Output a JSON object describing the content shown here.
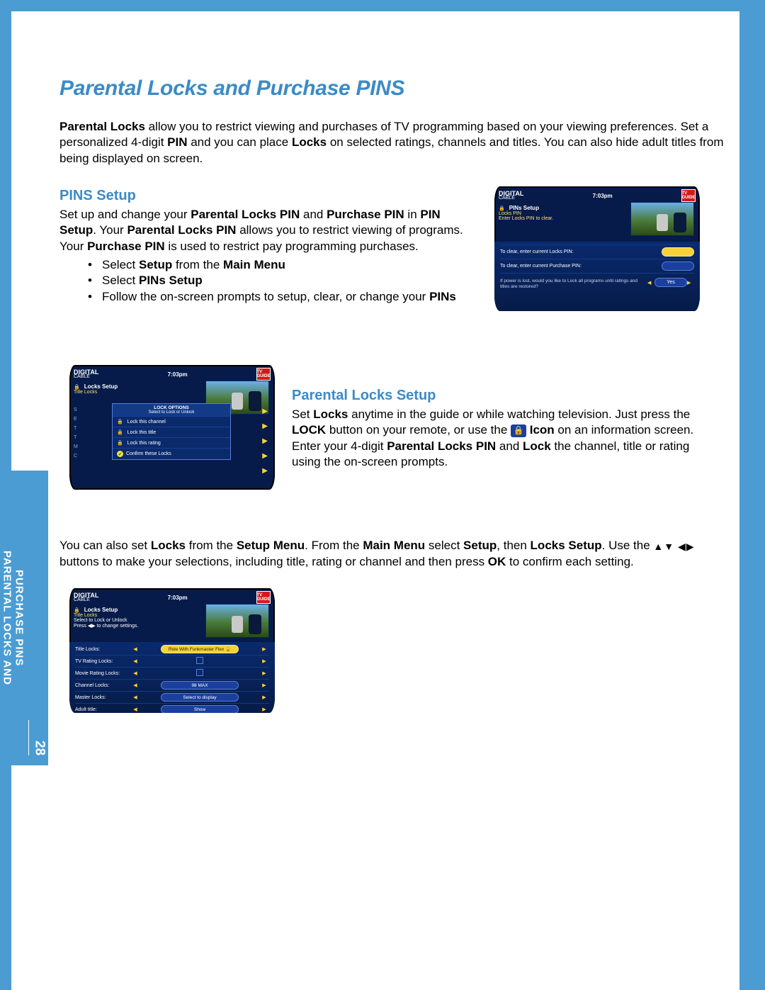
{
  "page": {
    "title": "Parental Locks and Purchase PINS",
    "number": "28",
    "margin_line1": "PARENTAL LOCKS AND",
    "margin_line2": "PURCHASE PINS"
  },
  "intro": {
    "p1a": "Parental Locks",
    "p1b": " allow you to restrict viewing and purchases of TV programming based on your viewing preferences. Set a personalized 4-digit ",
    "p1c": "PIN",
    "p1d": " and you can place ",
    "p1e": "Locks",
    "p1f": " on selected ratings, channels and titles. You can also hide adult titles from being displayed on screen."
  },
  "pins_setup": {
    "heading": "PINS Setup",
    "p_a": "Set up and change your ",
    "p_b": "Parental Locks PIN",
    "p_c": " and ",
    "p_d": "Purchase PIN",
    "p_e": " in ",
    "p_f": "PIN Setup",
    "p_g": ". Your ",
    "p_h": "Parental Locks PIN",
    "p_i": " allows you to restrict viewing of programs. Your ",
    "p_j": "Purchase PIN",
    "p_k": " is used to restrict pay programming purchases.",
    "b1a": "Select ",
    "b1b": "Setup",
    "b1c": " from the ",
    "b1d": "Main Menu",
    "b2a": "Select ",
    "b2b": "PINs Setup",
    "b3a": "Follow the on-screen prompts to setup, clear, or change your ",
    "b3b": "PINs"
  },
  "locks_setup": {
    "heading": "Parental Locks Setup",
    "p_a": "Set ",
    "p_b": "Locks",
    "p_c": " anytime in the guide or while watching television. Just press the ",
    "p_d": "LOCK",
    "p_e": " button on your remote, or use the ",
    "p_f": " Icon",
    "p_g": " on an information screen. Enter your 4-digit ",
    "p_h": "Parental Locks PIN",
    "p_i": " and ",
    "p_j": "Lock",
    "p_k": " the channel, title or rating using the on-screen prompts."
  },
  "setup_menu": {
    "p_a": "You can also set ",
    "p_b": "Locks",
    "p_c": " from the ",
    "p_d": "Setup Menu",
    "p_e": ". From the ",
    "p_f": "Main Menu",
    "p_g": " select ",
    "p_h": "Setup",
    "p_i": ", then ",
    "p_j": "Locks Setup",
    "p_k": ". Use the ",
    "arrows": "▲▼  ◀▶",
    "p_l": "buttons to make your selections, including title, rating or channel and then press ",
    "p_m": "OK",
    "p_n": " to confirm each setting."
  },
  "shots": {
    "brand1": "DIGITAL",
    "brand2": "CABLE",
    "time": "7:03pm",
    "tvguide": "TV GUIDE",
    "pins": {
      "heading": "PINs Setup",
      "sub1": "Locks PIN",
      "sub2": "Enter Locks PIN to clear.",
      "line1": "To clear, enter current Locks PIN:",
      "line2": "To clear, enter current Purchase PIN:",
      "note": "If power is lost, would you like to Lock all programs until ratings and titles are restored?",
      "yes": "Yes"
    },
    "locks_options": {
      "heading": "Locks Setup",
      "sub": "Title Locks",
      "box_title": "LOCK OPTIONS",
      "box_sub": "Select to Lock or Unlock",
      "opt1": "Lock this channel",
      "opt2": "Lock this title",
      "opt3": "Lock this rating",
      "opt4": "Confirm these Locks"
    },
    "locks_table": {
      "heading": "Locks Setup",
      "sub1": "Title Locks",
      "sub2": "Select to Lock or Unlock",
      "sub3": "Press ◀▶ to change settings.",
      "rows": [
        {
          "label": "Title Locks:",
          "value": "Ride With Funkmaster Flex 🔒",
          "yellow": true
        },
        {
          "label": "TV Rating Locks:",
          "value": "☑",
          "yellow": false
        },
        {
          "label": "Movie Rating Locks:",
          "value": "☑",
          "yellow": false
        },
        {
          "label": "Channel Locks:",
          "value": "98 MAX",
          "yellow": false
        },
        {
          "label": "Master Locks:",
          "value": "Select to display",
          "yellow": false
        },
        {
          "label": "Adult title:",
          "value": "Show",
          "yellow": false
        }
      ]
    }
  }
}
